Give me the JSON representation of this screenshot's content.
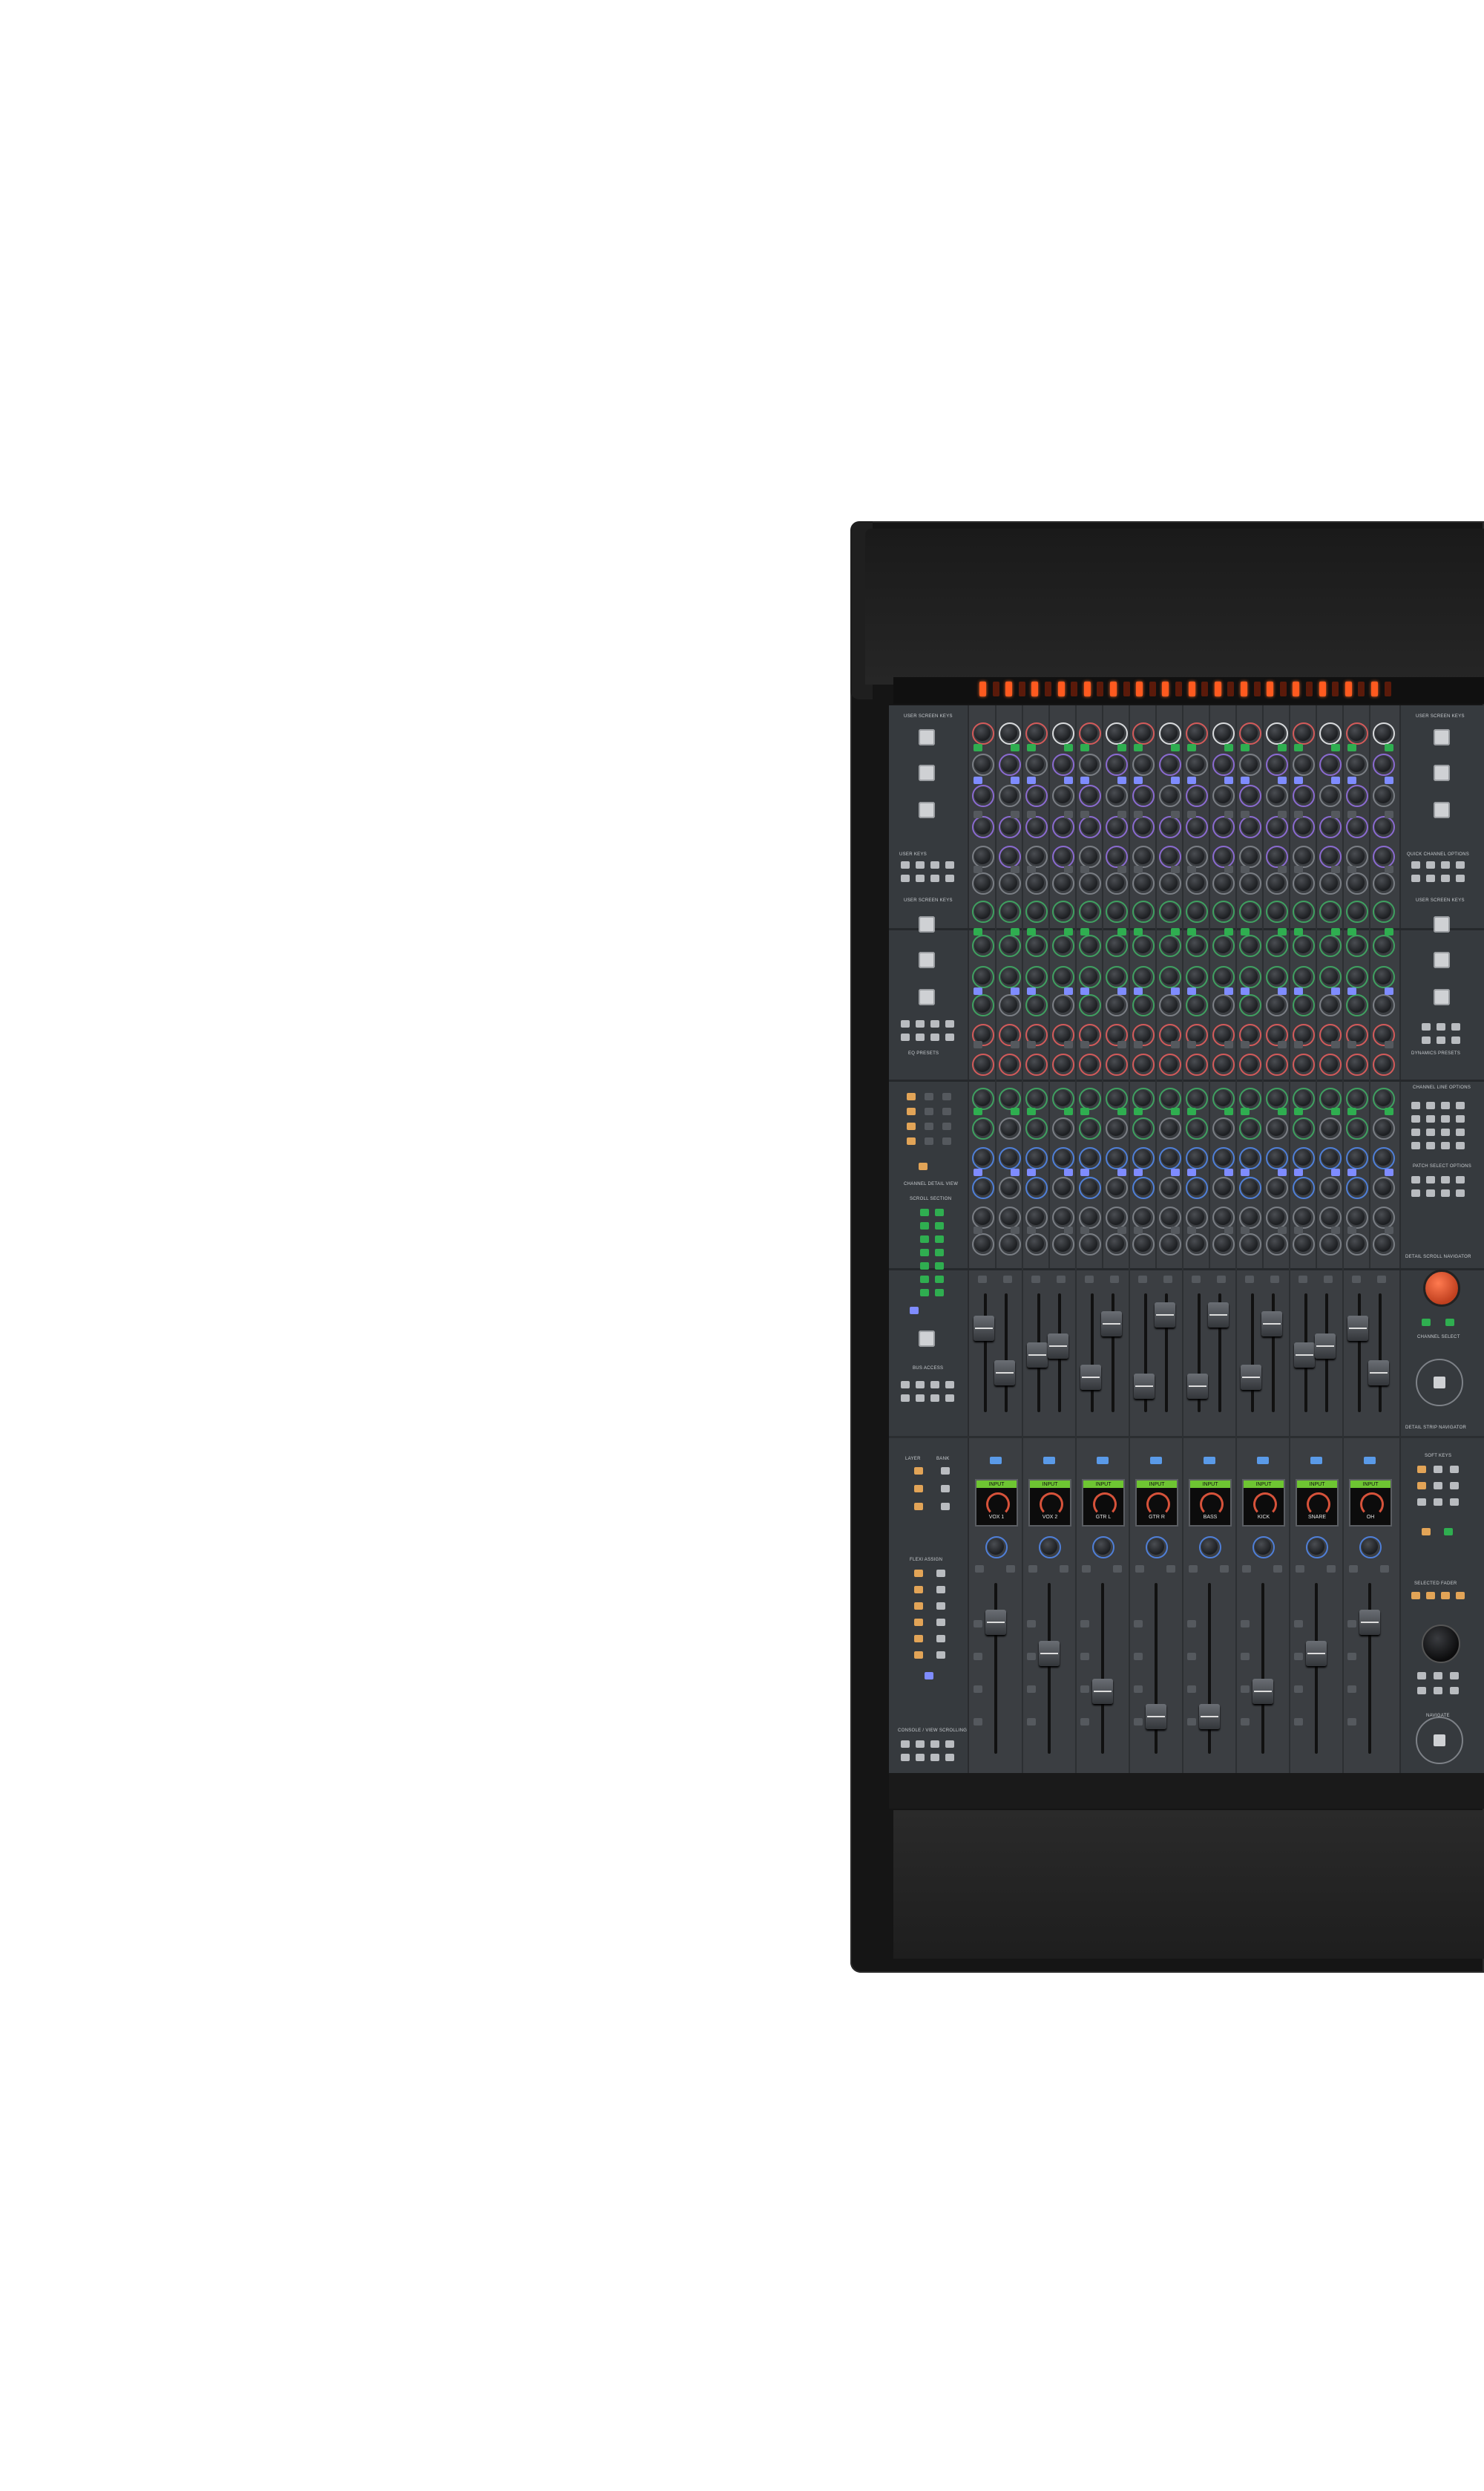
{
  "labels": {
    "user_screen_keys": "USER SCREEN KEYS",
    "quick_channel_options": "QUICK CHANNEL OPTIONS",
    "user_screen_keys_2": "USER SCREEN KEYS",
    "channel_line_options": "CHANNEL LINE OPTIONS",
    "eq_presets": "EQ PRESETS",
    "dynamics_presets": "DYNAMICS PRESETS",
    "detail_scroll_navigator": "DETAIL SCROLL NAVIGATOR",
    "channel_select": "CHANNEL SELECT",
    "detail_strip_navigator": "DETAIL STRIP NAVIGATOR",
    "layer_bank": "LAYER BANK",
    "flexi_assign": "FLEXI ASSIGN",
    "soft_keys": "SOFT KEYS",
    "selected_fader": "SELECTED FADER",
    "navigate": "NAVIGATE",
    "console_view": "CONSOLE / VIEW SCROLLING",
    "user_keys": "USER KEYS",
    "channel_detail_view": "CHANNEL DETAIL VIEW",
    "scroll_section": "SCROLL SECTION",
    "bus_access": "BUS ACCESS",
    "layer": "LAYER",
    "bank": "BANK",
    "eq": "EQ",
    "patch_select": "PATCH SELECT OPTIONS"
  },
  "strips": [
    {
      "disp_top": "INPUT",
      "disp_bottom": "VOX 1"
    },
    {
      "disp_top": "INPUT",
      "disp_bottom": "VOX 2"
    },
    {
      "disp_top": "INPUT",
      "disp_bottom": "GTR L"
    },
    {
      "disp_top": "INPUT",
      "disp_bottom": "GTR R"
    },
    {
      "disp_top": "INPUT",
      "disp_bottom": "BASS"
    },
    {
      "disp_top": "INPUT",
      "disp_bottom": "KICK"
    },
    {
      "disp_top": "INPUT",
      "disp_bottom": "SNARE"
    },
    {
      "disp_top": "INPUT",
      "disp_bottom": "OH"
    }
  ],
  "colors": {
    "panel": "#3b3e42",
    "led_on": "#ff5a1f",
    "display_header": "#6ec532",
    "select_button": "#5a9ae8",
    "amber": "#e2a457"
  },
  "icons": {
    "navigator": "dpad-icon",
    "big_knob": "rotary-encoder-icon"
  }
}
